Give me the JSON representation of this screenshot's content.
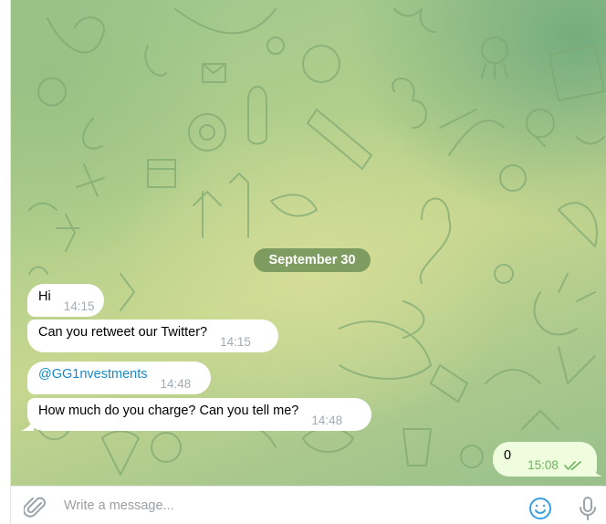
{
  "chat": {
    "date_separator": "September 30",
    "incoming": [
      {
        "text": "Hi",
        "time": "14:15"
      },
      {
        "text": "Can you retweet our Twitter?",
        "time": "14:15"
      },
      {
        "text": "@GG1nvestments",
        "time": "14:48",
        "is_link": true
      },
      {
        "text": "How much do you charge? Can you tell me?",
        "time": "14:48"
      }
    ],
    "outgoing": [
      {
        "text": "0",
        "time": "15:08",
        "status": "read",
        "status_icon": "double-check-icon"
      }
    ]
  },
  "composer": {
    "placeholder": "Write a message...",
    "attach_icon": "paperclip-icon",
    "emoji_icon": "smile-icon",
    "voice_icon": "microphone-icon"
  },
  "colors": {
    "incoming_bubble": "#ffffff",
    "outgoing_bubble": "#effdde",
    "link": "#168acd",
    "time_incoming": "#a0acb6",
    "time_outgoing": "#6cb25a",
    "date_pill": "#688a52",
    "accent_icon": "#3a9ee2"
  }
}
